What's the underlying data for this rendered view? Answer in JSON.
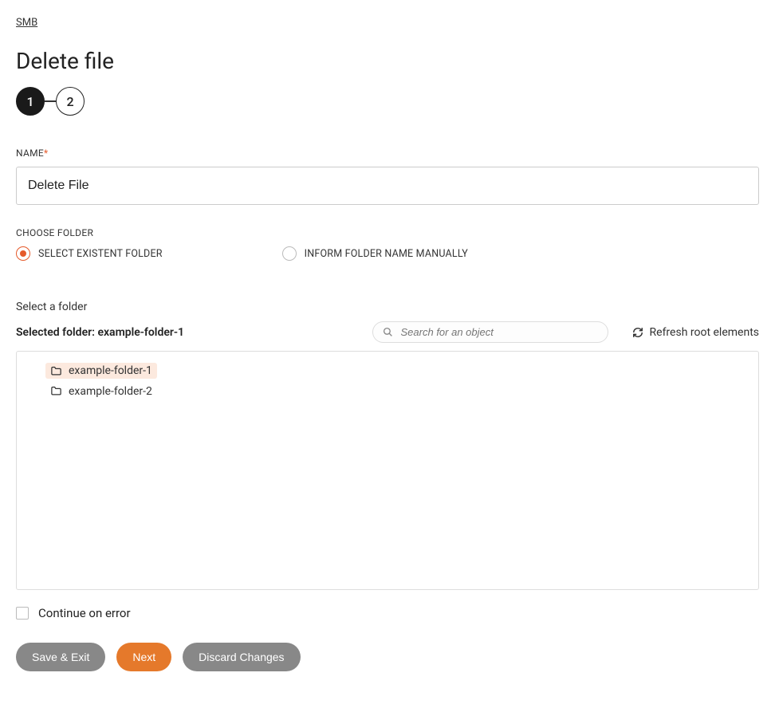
{
  "breadcrumb": "SMB",
  "pageTitle": "Delete file",
  "stepper": {
    "step1": "1",
    "step2": "2"
  },
  "nameField": {
    "label": "NAME",
    "value": "Delete File"
  },
  "chooseFolder": {
    "label": "CHOOSE FOLDER",
    "options": {
      "existent": "SELECT EXISTENT FOLDER",
      "manual": "INFORM FOLDER NAME MANUALLY"
    }
  },
  "folderPicker": {
    "heading": "Select a folder",
    "selectedPrefix": "Selected folder: ",
    "selectedValue": "example-folder-1",
    "searchPlaceholder": "Search for an object",
    "refreshLabel": "Refresh root elements",
    "tree": [
      {
        "name": "example-folder-1",
        "selected": true
      },
      {
        "name": "example-folder-2",
        "selected": false
      }
    ]
  },
  "continueOnError": "Continue on error",
  "buttons": {
    "saveExit": "Save & Exit",
    "next": "Next",
    "discard": "Discard Changes"
  }
}
